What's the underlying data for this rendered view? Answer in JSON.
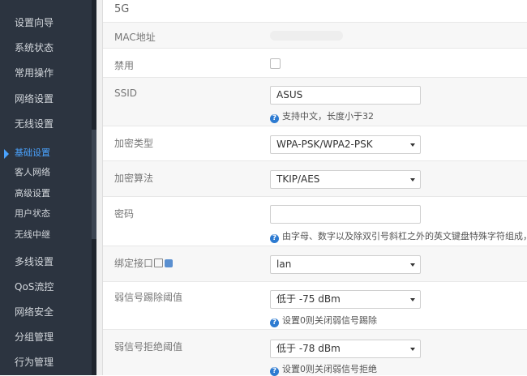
{
  "sidebar": {
    "items": [
      {
        "label": "设置向导"
      },
      {
        "label": "系统状态"
      },
      {
        "label": "常用操作"
      },
      {
        "label": "网络设置"
      },
      {
        "label": "无线设置"
      }
    ],
    "sub_items": [
      {
        "label": "基础设置",
        "active": true
      },
      {
        "label": "客人网络"
      },
      {
        "label": "高级设置"
      },
      {
        "label": "用户状态"
      },
      {
        "label": "无线中继"
      }
    ],
    "items_after": [
      {
        "label": "多线设置"
      },
      {
        "label": "QoS流控"
      },
      {
        "label": "网络安全"
      },
      {
        "label": "分组管理"
      },
      {
        "label": "行为管理"
      }
    ]
  },
  "form": {
    "section_title": "5G",
    "mac": {
      "label": "MAC地址"
    },
    "disable": {
      "label": "禁用",
      "checked": false
    },
    "ssid": {
      "label": "SSID",
      "value": "ASUS",
      "hint": "支持中文，长度小于32"
    },
    "encryption_type": {
      "label": "加密类型",
      "value": "WPA-PSK/WPA2-PSK"
    },
    "encryption_algorithm": {
      "label": "加密算法",
      "value": "TKIP/AES"
    },
    "password": {
      "label": "密码",
      "value": "",
      "hint": "由字母、数字以及除双引号斜杠之外的英文键盘特殊字符组成，"
    },
    "bind_interface": {
      "label": "绑定接口",
      "value": "lan"
    },
    "weak_kick_threshold": {
      "label": "弱信号踢除阈值",
      "value": "低于 -75 dBm",
      "hint": "设置0则关闭弱信号踢除"
    },
    "weak_reject_threshold": {
      "label": "弱信号拒绝阈值",
      "value": "低于 -78 dBm",
      "hint": "设置0则关闭弱信号拒绝"
    }
  },
  "icons": {
    "hint": "question-circle-icon",
    "nav_active": "caret-right-icon"
  },
  "colors": {
    "sidebar_bg": "#2c3440",
    "accent": "#4aa3ff",
    "hint_icon": "#2d7bd1"
  }
}
